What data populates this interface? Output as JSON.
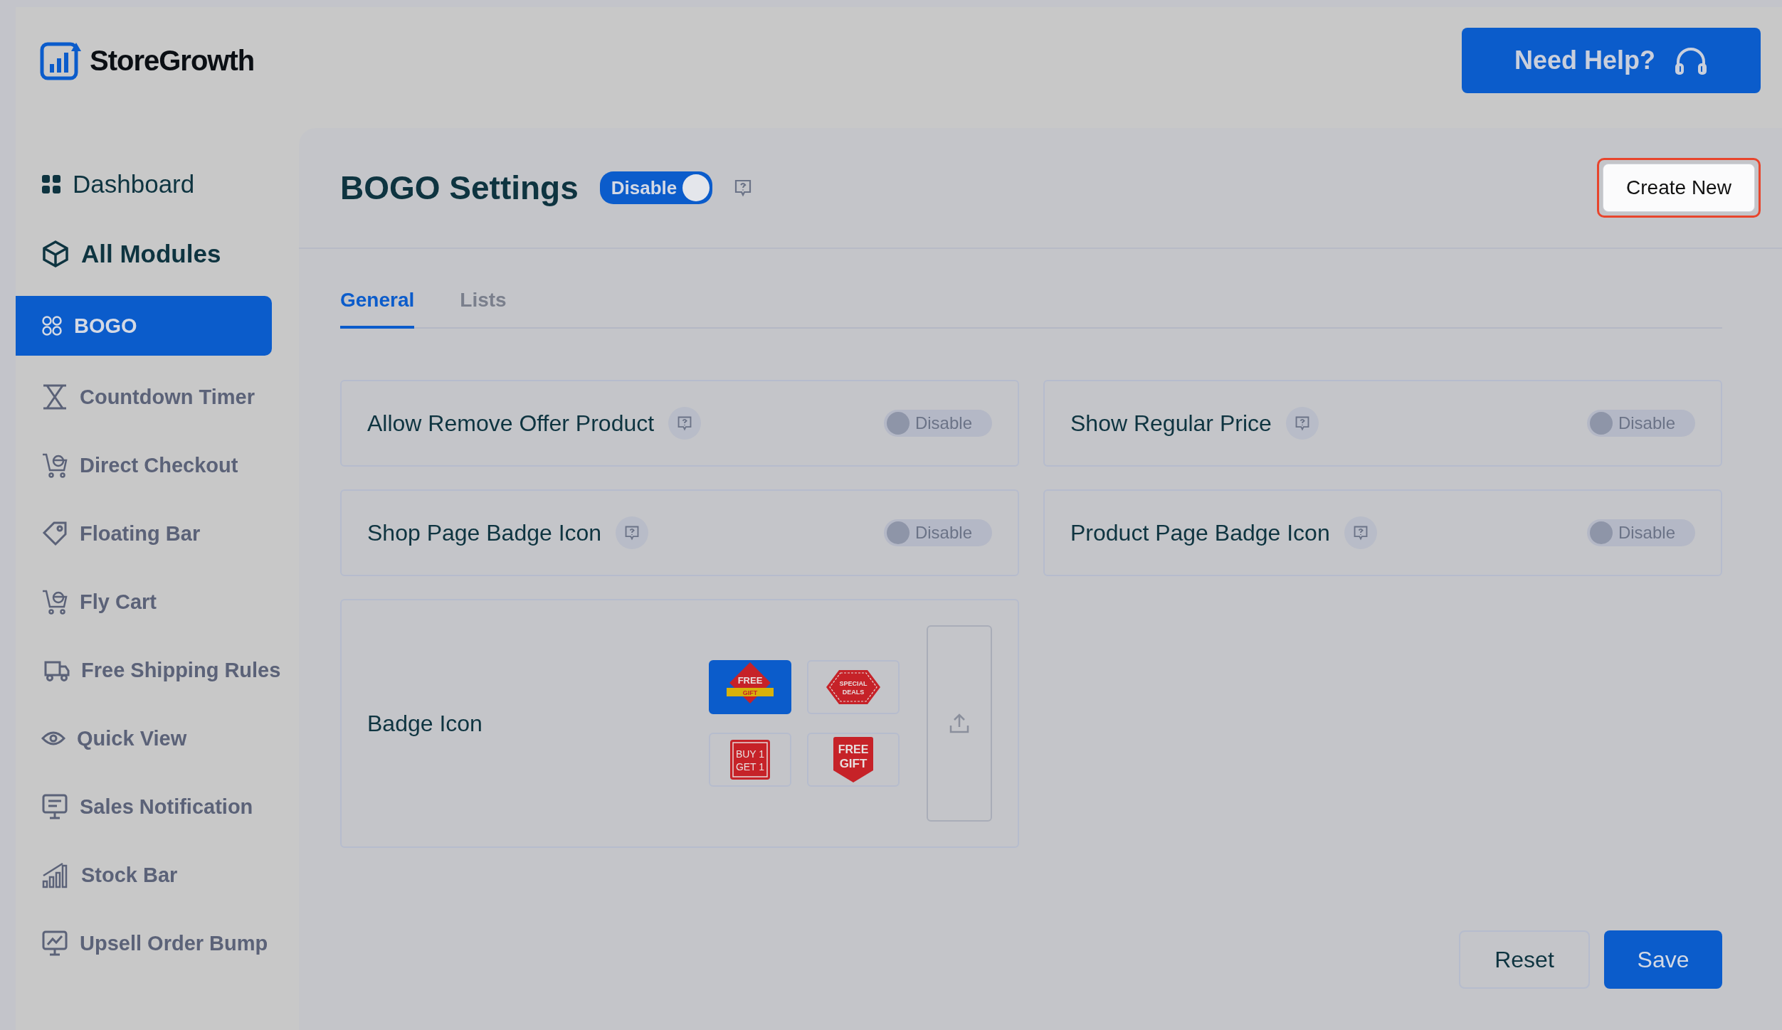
{
  "brand": {
    "name": "StoreGrowth"
  },
  "help_button": {
    "label": "Need Help?"
  },
  "sidebar": {
    "items": [
      {
        "label": "Dashboard",
        "kind": "main",
        "selected": false
      },
      {
        "label": "All Modules",
        "kind": "main",
        "selected": false
      },
      {
        "label": "BOGO",
        "kind": "module",
        "selected": true
      },
      {
        "label": "Countdown Timer",
        "kind": "module",
        "selected": false
      },
      {
        "label": "Direct Checkout",
        "kind": "module",
        "selected": false
      },
      {
        "label": "Floating Bar",
        "kind": "module",
        "selected": false
      },
      {
        "label": "Fly Cart",
        "kind": "module",
        "selected": false
      },
      {
        "label": "Free Shipping Rules",
        "kind": "module",
        "selected": false
      },
      {
        "label": "Quick View",
        "kind": "module",
        "selected": false
      },
      {
        "label": "Sales Notification",
        "kind": "module",
        "selected": false
      },
      {
        "label": "Stock Bar",
        "kind": "module",
        "selected": false
      },
      {
        "label": "Upsell Order Bump",
        "kind": "module",
        "selected": false
      }
    ]
  },
  "page": {
    "title": "BOGO Settings",
    "toggle": {
      "label": "Disable",
      "on": true
    },
    "create_button": {
      "label": "Create New",
      "highlighted": true
    }
  },
  "tabs": [
    {
      "label": "General",
      "selected": true
    },
    {
      "label": "Lists",
      "selected": false
    }
  ],
  "settings": [
    {
      "label": "Allow Remove Offer Product",
      "toggle": {
        "label": "Disable",
        "on": false
      }
    },
    {
      "label": "Show Regular Price",
      "toggle": {
        "label": "Disable",
        "on": false
      }
    },
    {
      "label": "Shop Page Badge Icon",
      "toggle": {
        "label": "Disable",
        "on": false
      }
    },
    {
      "label": "Product Page Badge Icon",
      "toggle": {
        "label": "Disable",
        "on": false
      }
    }
  ],
  "badge_icon": {
    "label": "Badge Icon",
    "options": [
      {
        "kind": "diamond",
        "lines": [
          "FREE",
          "GIFT"
        ],
        "selected": true
      },
      {
        "kind": "seal",
        "lines": [
          "SPECIAL",
          "DEALS"
        ],
        "selected": false
      },
      {
        "kind": "square",
        "lines": [
          "BUY 1",
          "GET 1"
        ],
        "selected": false
      },
      {
        "kind": "shield",
        "lines": [
          "FREE",
          "GIFT"
        ],
        "selected": false
      }
    ]
  },
  "buttons": [
    {
      "label": "Reset",
      "kind": "secondary"
    },
    {
      "label": "Save",
      "kind": "primary"
    }
  ]
}
